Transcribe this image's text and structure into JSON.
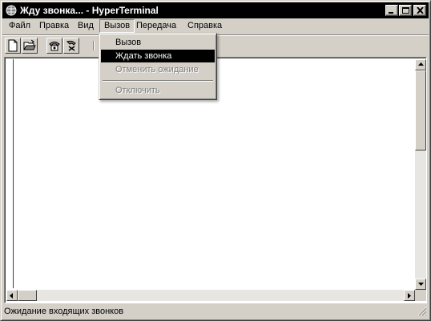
{
  "window": {
    "title": "Жду звонка... - HyperTerminal"
  },
  "menubar": {
    "items": [
      "Файл",
      "Правка",
      "Вид",
      "Вызов",
      "Передача",
      "Справка"
    ],
    "open_index": 3
  },
  "call_menu": {
    "items": [
      {
        "label": "Вызов",
        "state": "enabled"
      },
      {
        "label": "Ждать звонка",
        "state": "highlighted"
      },
      {
        "label": "Отменить ожидание",
        "state": "disabled"
      },
      {
        "label": "Отключить",
        "state": "disabled"
      }
    ]
  },
  "toolbar": {
    "icons": [
      "new-document-icon",
      "open-folder-icon",
      "connect-phone-icon",
      "disconnect-phone-icon"
    ]
  },
  "status": {
    "text": "Ожидание входящих звонков"
  },
  "colors": {
    "face": "#d4d0c8",
    "titlebar": "#000000",
    "highlight": "#000000",
    "disabled_text": "#808080"
  }
}
